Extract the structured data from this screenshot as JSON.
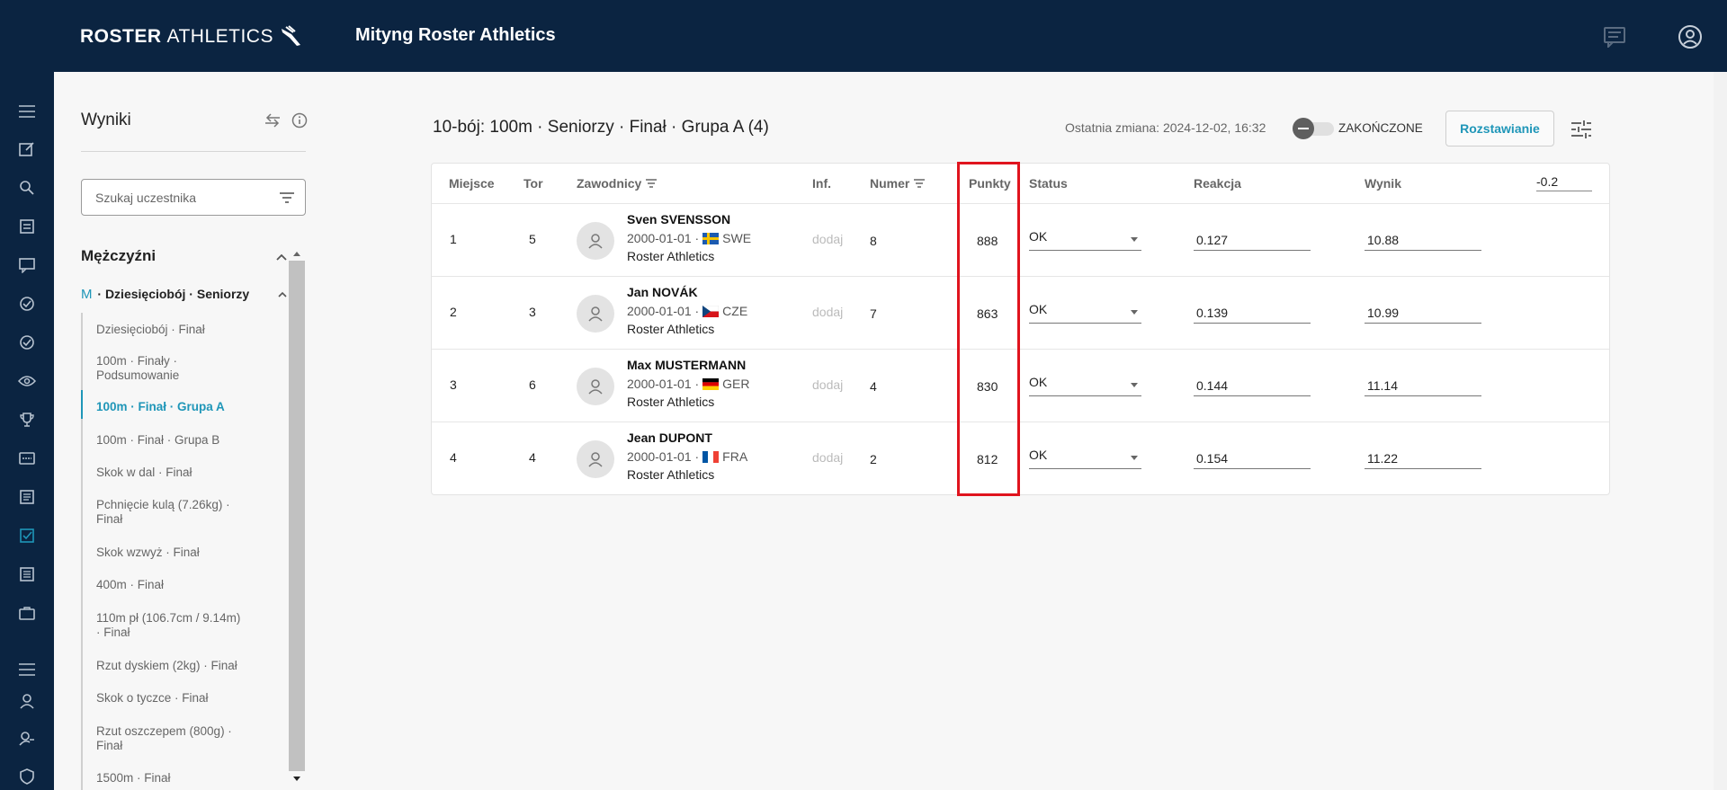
{
  "app": {
    "brand_bold": "ROSTER",
    "brand_light": "ATHLETICS",
    "meet_title": "Mityng Roster Athletics"
  },
  "sidebar": {
    "title": "Wyniki",
    "search_placeholder": "Szukaj uczestnika",
    "group_title": "Mężczyźni",
    "sub_prefix": "M",
    "sub_title": "· Dziesięciobój · Seniorzy",
    "items": [
      "Dziesięciobój · Finał",
      "100m · Finały · Podsumowanie",
      "100m · Finał · Grupa A",
      "100m · Finał · Grupa B",
      "Skok w dal · Finał",
      "Pchnięcie kulą (7.26kg) · Finał",
      "Skok wzwyż · Finał",
      "400m · Finał",
      "110m pł (106.7cm / 9.14m) · Finał",
      "Rzut dyskiem (2kg) · Finał",
      "Skok o tyczce · Finał",
      "Rzut oszczepem (800g) · Finał",
      "1500m · Finał"
    ],
    "active_index": 2
  },
  "header": {
    "event_title": "10-bój: 100m · Seniorzy · Finał · Grupa A (4)",
    "last_change": "Ostatnia zmiana: 2024-12-02, 16:32",
    "toggle_label": "ZAKOŃCZONE",
    "start_button": "Rozstawianie"
  },
  "table": {
    "columns": {
      "place": "Miejsce",
      "lane": "Tor",
      "athletes": "Zawodnicy",
      "info": "Inf.",
      "number": "Numer",
      "points": "Punkty",
      "status": "Status",
      "reaction": "Reakcja",
      "result": "Wynik"
    },
    "wind": "-0.2",
    "rows": [
      {
        "place": "1",
        "lane": "5",
        "name": "Sven SVENSSON",
        "dob": "2000-01-01 ·",
        "country": "SWE",
        "club": "Roster Athletics",
        "info": "dodaj",
        "number": "8",
        "points": "888",
        "status": "OK",
        "reaction": "0.127",
        "result": "10.88"
      },
      {
        "place": "2",
        "lane": "3",
        "name": "Jan NOVÁK",
        "dob": "2000-01-01 ·",
        "country": "CZE",
        "club": "Roster Athletics",
        "info": "dodaj",
        "number": "7",
        "points": "863",
        "status": "OK",
        "reaction": "0.139",
        "result": "10.99"
      },
      {
        "place": "3",
        "lane": "6",
        "name": "Max MUSTERMANN",
        "dob": "2000-01-01 ·",
        "country": "GER",
        "club": "Roster Athletics",
        "info": "dodaj",
        "number": "4",
        "points": "830",
        "status": "OK",
        "reaction": "0.144",
        "result": "11.14"
      },
      {
        "place": "4",
        "lane": "4",
        "name": "Jean DUPONT",
        "dob": "2000-01-01 ·",
        "country": "FRA",
        "club": "Roster Athletics",
        "info": "dodaj",
        "number": "2",
        "points": "812",
        "status": "OK",
        "reaction": "0.154",
        "result": "11.22"
      }
    ]
  },
  "colors": {
    "navy": "#0b2441",
    "accent": "#1f96b8",
    "highlight": "#e0141e"
  }
}
